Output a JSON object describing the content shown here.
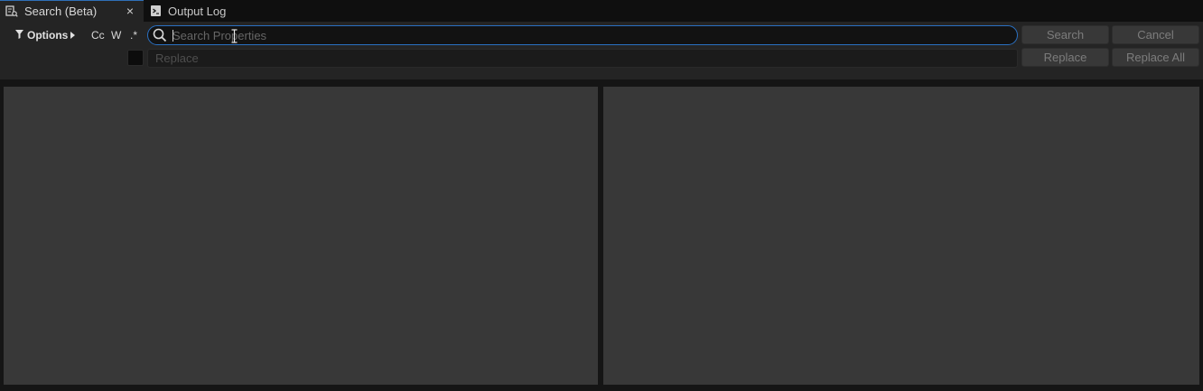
{
  "tabs": [
    {
      "label": "Search (Beta)",
      "icon": "search-beta-icon",
      "active": true,
      "close": "×"
    },
    {
      "label": "Output Log",
      "icon": "output-log-icon",
      "active": false
    }
  ],
  "toolbar": {
    "options_label": "Options",
    "toggles": {
      "case": "Cc",
      "whole_word": "W",
      "regex": ".*"
    },
    "search": {
      "placeholder": "Search Properties",
      "value": ""
    },
    "replace": {
      "placeholder": "Replace",
      "value": "",
      "checked": false
    },
    "buttons": {
      "search": "Search",
      "cancel": "Cancel",
      "replace": "Replace",
      "replace_all": "Replace All"
    }
  },
  "colors": {
    "accent": "#2a70c2",
    "panel": "#383838",
    "background": "#242424"
  }
}
